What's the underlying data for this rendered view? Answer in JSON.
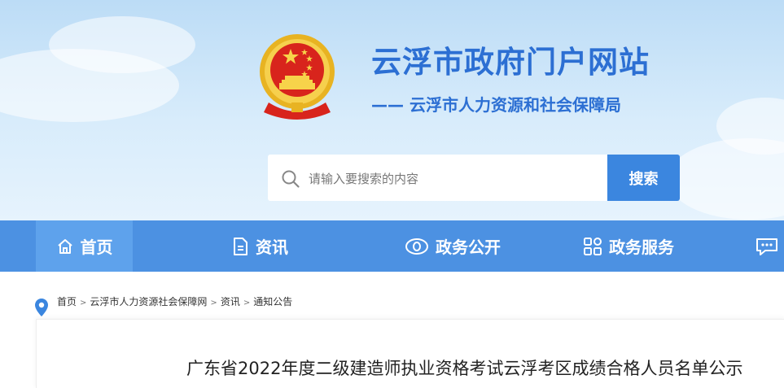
{
  "header": {
    "site_title": "云浮市政府门户网站",
    "department": "—— 云浮市人力资源和社会保障局",
    "emblem_icon": "national-emblem"
  },
  "search": {
    "placeholder": "请输入要搜索的内容",
    "button_label": "搜索",
    "icon": "search-icon"
  },
  "nav": {
    "items": [
      {
        "label": "首页",
        "icon": "home-icon",
        "active": true
      },
      {
        "label": "资讯",
        "icon": "document-icon"
      },
      {
        "label": "政务公开",
        "icon": "eye-icon"
      },
      {
        "label": "政务服务",
        "icon": "grid-icon"
      },
      {
        "label": "",
        "icon": "chat-icon"
      }
    ]
  },
  "breadcrumb": {
    "items": [
      "首页",
      "云浮市人力资源社会保障网",
      "资讯",
      "通知公告"
    ],
    "separator": ">"
  },
  "article": {
    "title": "广东省2022年度二级建造师执业资格考试云浮考区成绩合格人员名单公示"
  },
  "colors": {
    "brand_blue": "#2c6fd3",
    "nav_bg": "#4c91e2",
    "nav_active": "#5ea2ec",
    "search_button": "#3b86df"
  }
}
